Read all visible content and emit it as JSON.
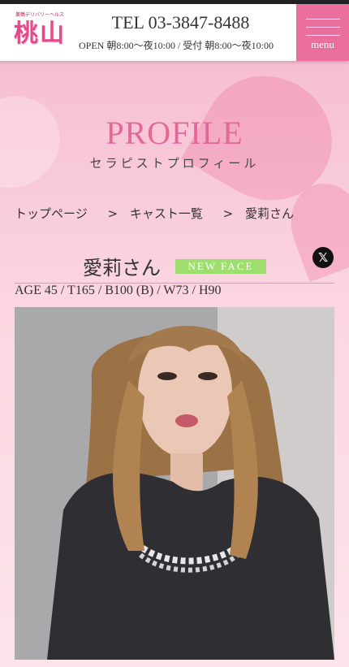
{
  "header": {
    "logo_small": "巣鴨デリバリーヘルス",
    "logo_text": "桃山",
    "tel": "TEL 03-3847-8488",
    "hours": "OPEN 朝8:00〜夜10:00 / 受付 朝8:00〜夜10:00",
    "menu_label": "menu"
  },
  "page": {
    "title": "PROFILE",
    "subtitle": "セラピストプロフィール"
  },
  "breadcrumb": {
    "items": [
      "トップページ",
      "キャスト一覧",
      "愛莉さん"
    ],
    "separator": ">"
  },
  "profile": {
    "name": "愛莉さん",
    "badge": "NEW FACE",
    "specs": "AGE 45 / T165 / B100 (B) / W73 / H90",
    "share_icon": "x-logo-icon",
    "share_glyph": "𝕏"
  },
  "colors": {
    "accent": "#ea6f9e",
    "title": "#e2689a",
    "badge": "#9ede6e"
  }
}
